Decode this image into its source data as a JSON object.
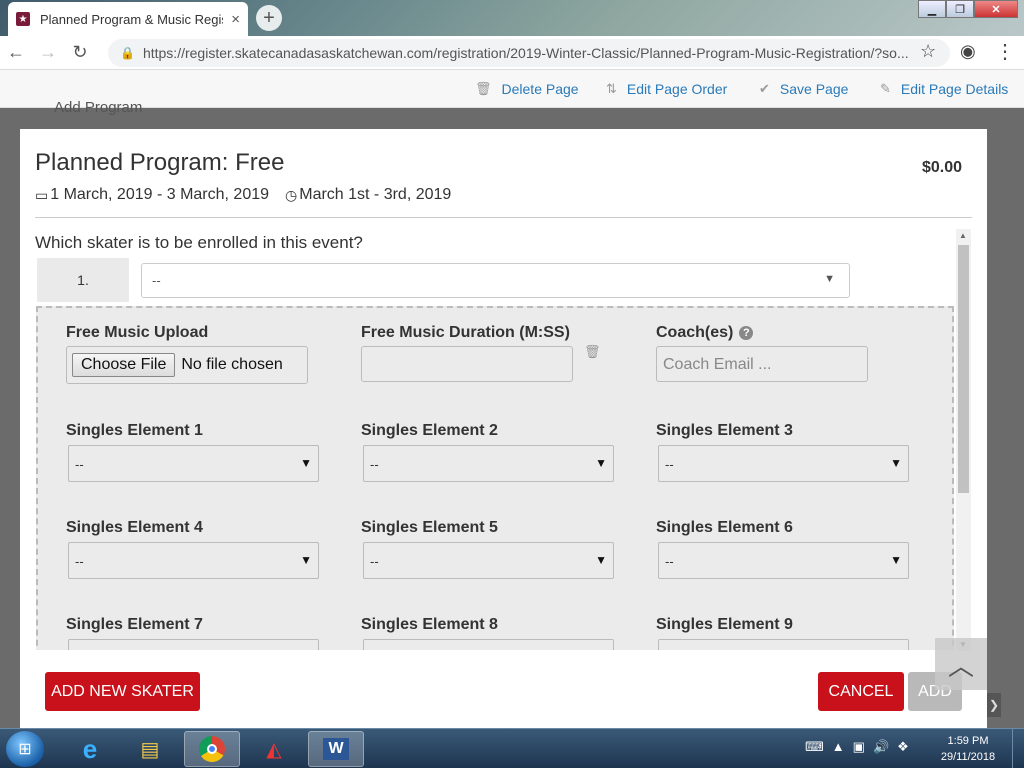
{
  "browser": {
    "tab_title": "Planned Program & Music Regist",
    "tab_close": "×",
    "new_tab": "+",
    "url": "https://register.skatecanadasaskatchewan.com/registration/2019-Winter-Classic/Planned-Program-Music-Registration/?so..."
  },
  "page_toolbar": {
    "delete_page": "Delete Page",
    "edit_page_order": "Edit Page Order",
    "save_page": "Save Page",
    "edit_page_details": "Edit Page Details"
  },
  "background": {
    "add_program": "Add Program"
  },
  "modal": {
    "title": "Planned Program: Free",
    "price": "$0.00",
    "dates": "1 March, 2019 - 3 March, 2019",
    "time": "March 1st - 3rd, 2019",
    "question": "Which skater is to be enrolled in this event?",
    "skater_number": "1.",
    "skater_selected": "--",
    "fields": {
      "music_upload_label": "Free Music Upload",
      "choose_file": "Choose File",
      "no_file": "No file chosen",
      "duration_label": "Free Music Duration (M:SS)",
      "duration_value": "",
      "coach_label": "Coach(es)",
      "coach_placeholder": "Coach Email ..."
    },
    "elements": [
      {
        "label": "Singles Element 1",
        "value": "--"
      },
      {
        "label": "Singles Element 2",
        "value": "--"
      },
      {
        "label": "Singles Element 3",
        "value": "--"
      },
      {
        "label": "Singles Element 4",
        "value": "--"
      },
      {
        "label": "Singles Element 5",
        "value": "--"
      },
      {
        "label": "Singles Element 6",
        "value": "--"
      },
      {
        "label": "Singles Element 7",
        "value": "--"
      },
      {
        "label": "Singles Element 8",
        "value": "--"
      },
      {
        "label": "Singles Element 9",
        "value": "--"
      }
    ],
    "buttons": {
      "add_new_skater": "ADD NEW SKATER",
      "cancel": "CANCEL",
      "add": "ADD"
    }
  },
  "taskbar": {
    "time": "1:59 PM",
    "date": "29/11/2018"
  },
  "colors": {
    "accent_red": "#c8111a",
    "link_blue": "#2a7ab8",
    "disabled_gray": "#b9b9b9"
  }
}
